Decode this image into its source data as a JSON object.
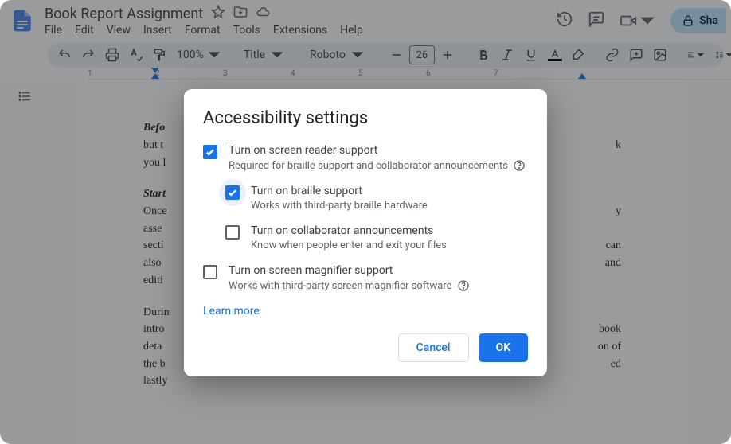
{
  "header": {
    "doc_title": "Book Report Assignment",
    "share_label": "Sha",
    "menus": [
      "File",
      "Edit",
      "View",
      "Insert",
      "Format",
      "Tools",
      "Extensions",
      "Help"
    ]
  },
  "toolbar": {
    "zoom": "100%",
    "style": "Title",
    "font": "Roboto",
    "font_size": "26"
  },
  "ruler": {
    "ticks": [
      "1",
      "2",
      "3",
      "4",
      "5",
      "6",
      "7"
    ]
  },
  "doc": {
    "p1_b": "Befo",
    "p1_l2": "but t",
    "p1_l3": "you l",
    "p1_r1": "k",
    "p2_b": "Start",
    "p2_l2": "Once",
    "p2_l3": "asse",
    "p2_l4": "secti",
    "p2_l5": "also",
    "p2_l6": "editi",
    "p2_r2": "y",
    "p2_r4": "can",
    "p2_r5": "and",
    "p3_l1": "Durin",
    "p3_l2": "intro",
    "p3_l3": "deta",
    "p3_l4": "the b",
    "p3_l5": "lastly",
    "p3_r2": "book",
    "p3_r3": "on of",
    "p3_r4": "ed"
  },
  "dialog": {
    "title": "Accessibility settings",
    "opt1_label": "Turn on screen reader support",
    "opt1_sub": "Required for braille support and collaborator announcements",
    "opt2_label": "Turn on braille support",
    "opt2_sub": "Works with third-party braille hardware",
    "opt3_label": "Turn on collaborator announcements",
    "opt3_sub": "Know when people enter and exit your files",
    "opt4_label": "Turn on screen magnifier support",
    "opt4_sub": "Works with third-party screen magnifier software",
    "learn_more": "Learn more",
    "cancel": "Cancel",
    "ok": "OK"
  }
}
